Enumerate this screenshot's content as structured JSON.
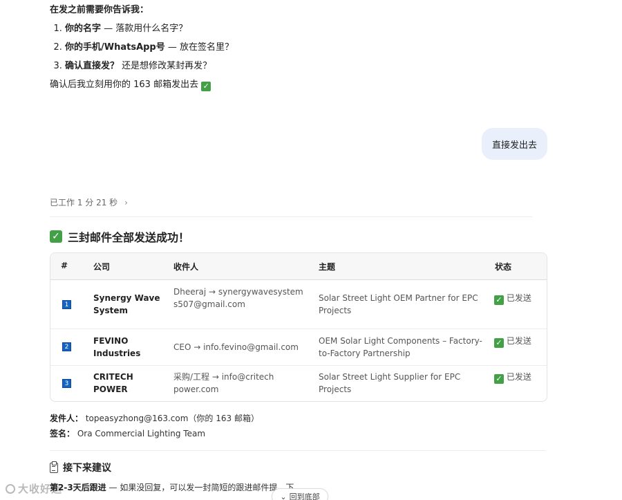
{
  "top_message": {
    "intro": "在发之前需要你告诉我：",
    "items": [
      {
        "bold": "你的名字",
        "rest": " — 落款用什么名字？"
      },
      {
        "bold": "你的手机/WhatsApp号",
        "rest": " — 放在签名里？"
      },
      {
        "bold": "确认直接发？",
        "rest": " 还是想修改某封再发？"
      }
    ],
    "confirm": "确认后我立刻用你的 163 邮箱发出去 "
  },
  "user_message": "直接发出去",
  "worked": {
    "label": "已工作 1 分 21 秒",
    "chevron": "›"
  },
  "result": {
    "title": "三封邮件全部发送成功！",
    "check_icon": "✓",
    "headers": [
      "#",
      "公司",
      "收件人",
      "主题",
      "状态"
    ],
    "rows": [
      {
        "num": "1",
        "company": "Synergy Wave System",
        "recipient": "Dheeraj → synergywavesystems507@gmail.com",
        "subject": "Solar Street Light OEM Partner for EPC Projects",
        "status": "已发送"
      },
      {
        "num": "2",
        "company": "FEVINO Industries",
        "recipient": "CEO → info.fevino@gmail.com",
        "subject": "OEM Solar Light Components – Factory-to-Factory Partnership",
        "status": "已发送"
      },
      {
        "num": "3",
        "company": "CRITECH POWER",
        "recipient": "采购/工程 → info@critechpower.com",
        "subject": "Solar Street Light Supplier for EPC Projects",
        "status": "已发送"
      }
    ]
  },
  "sender": {
    "from_label": "发件人：",
    "from_value": "topeasyzhong@163.com（你的 163 邮箱）",
    "sign_label": "签名：",
    "sign_value": "Ora Commercial Lighting Team"
  },
  "next": {
    "title": "接下来建议",
    "bold": "第2-3天后跟进",
    "rest": " — 如果没回复，可以发一封简短的跟进邮件提…下"
  },
  "scroll_button": {
    "label": "回到底部",
    "icon": "⌄"
  },
  "watermark": "大收好运",
  "colors": {
    "check_green": "#43a047",
    "badge_blue": "#1565c0",
    "user_bubble": "#e9f0fb"
  }
}
